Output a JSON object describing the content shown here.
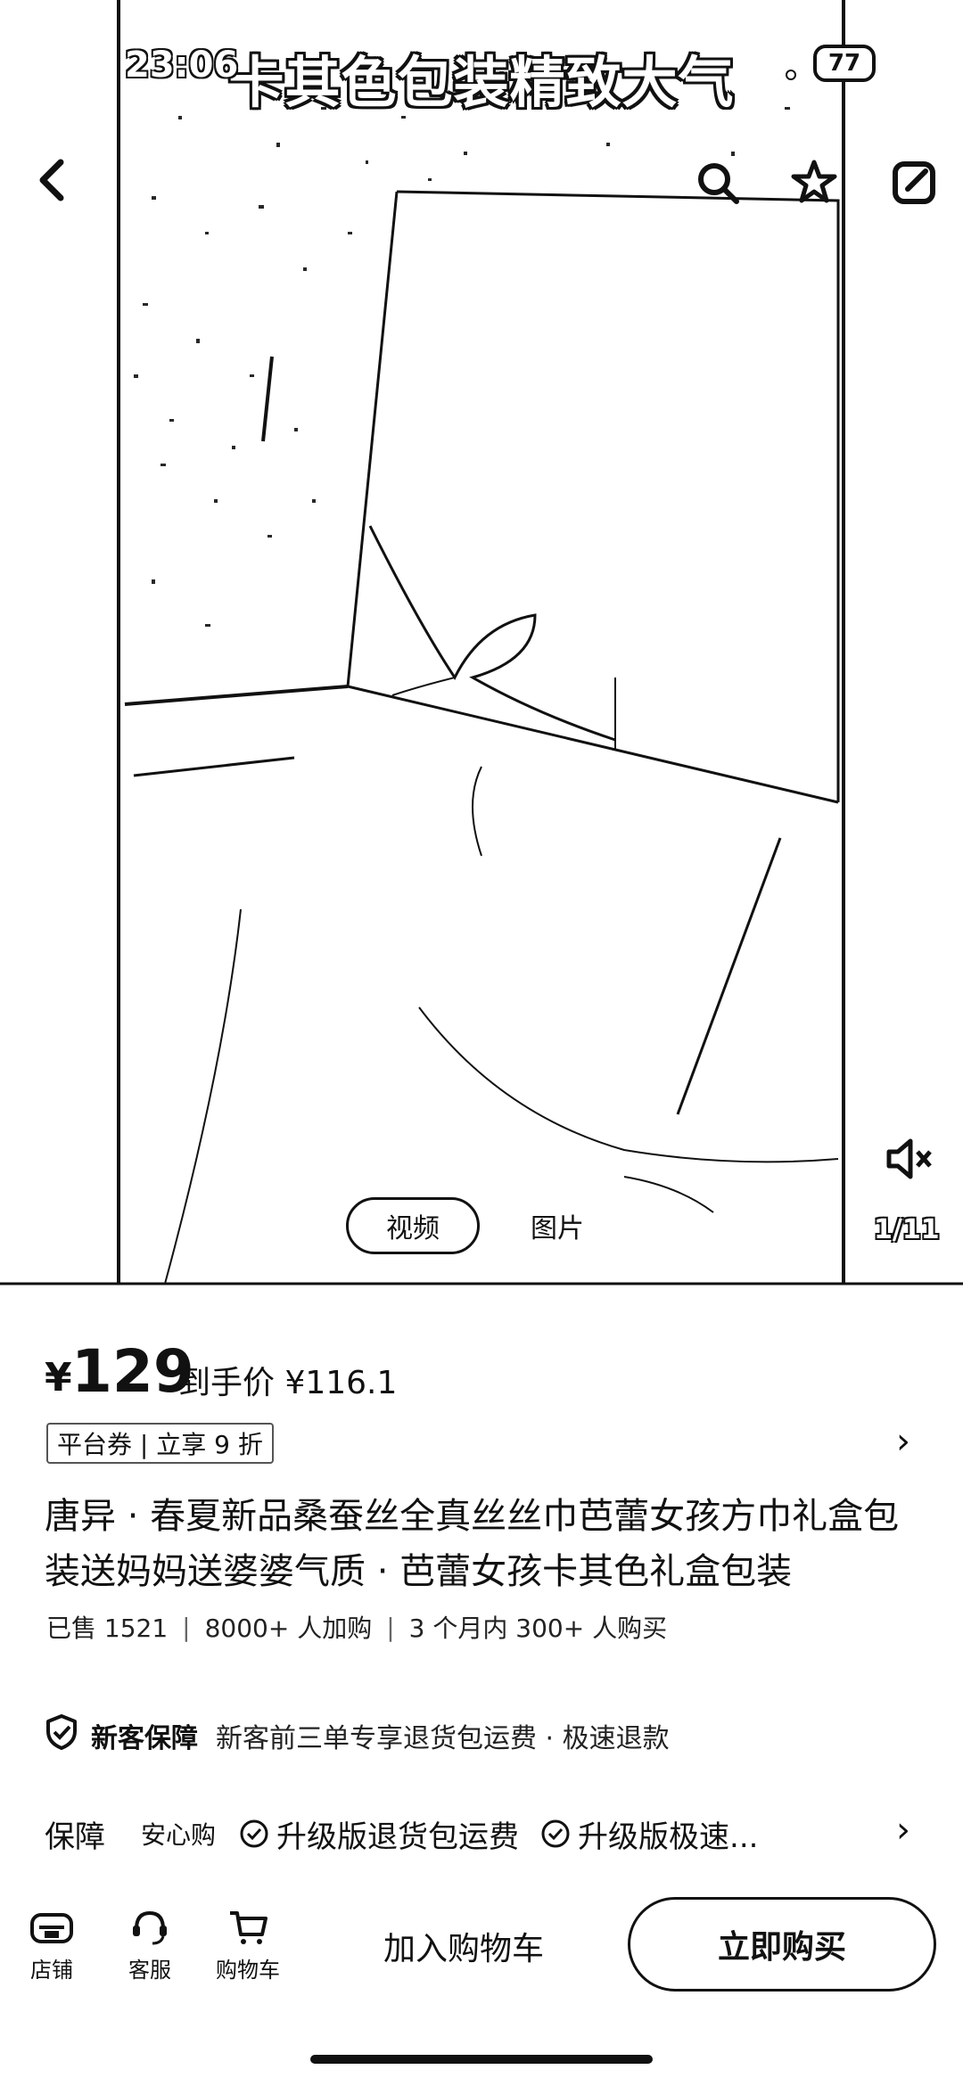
{
  "status": {
    "time": "23:06",
    "battery": "77"
  },
  "media": {
    "overlay_title": "卡其色包装精致大气",
    "tabs": [
      {
        "label": "视频",
        "active": true
      },
      {
        "label": "图片",
        "active": false
      }
    ],
    "page_indicator": "1/11"
  },
  "product": {
    "currency": "¥",
    "price": "129",
    "final_price_text": "到手价 ¥116.1",
    "coupon": "平台券 | 立享 9 折",
    "title": "唐异 · 春夏新品桑蚕丝全真丝丝巾芭蕾女孩方巾礼盒包装送妈妈送婆婆气质 · 芭蕾女孩卡其色礼盒包装",
    "stats": {
      "sold": "已售 1521",
      "carted": "8000+ 人加购",
      "bought": "3 个月内 300+ 人购买"
    }
  },
  "guarantee": {
    "label": "新客保障",
    "desc": "新客前三单专享退货包运费 · 极速退款"
  },
  "assurance": {
    "head": "保障",
    "sub": "安心购",
    "items": [
      "升级版退货包运费",
      "升级版极速..."
    ]
  },
  "bottom_bar": {
    "shop": "店铺",
    "service": "客服",
    "cart": "购物车",
    "add_to_cart": "加入购物车",
    "buy_now": "立即购买"
  }
}
